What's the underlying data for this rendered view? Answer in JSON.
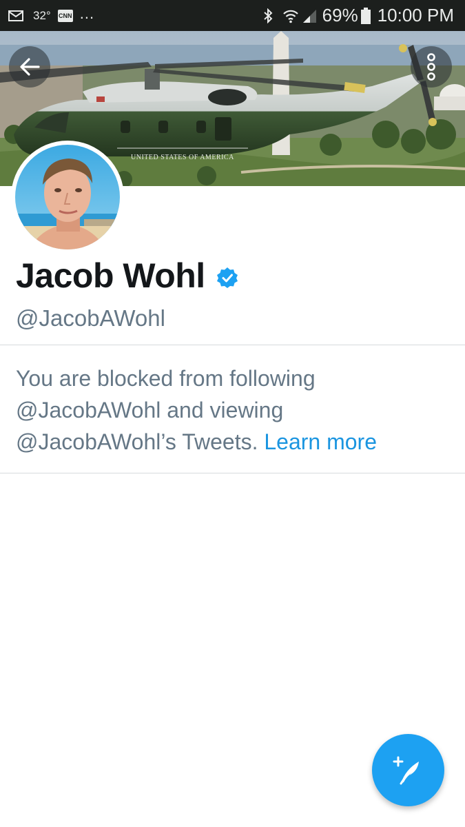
{
  "status_bar": {
    "temperature": "32°",
    "news_badge": "CNN",
    "more_indicator": "...",
    "battery_percent": "69%",
    "time": "10:00 PM",
    "icons": [
      "mail-icon",
      "cnn-icon",
      "bluetooth-icon",
      "wifi-icon",
      "signal-icon",
      "battery-icon"
    ]
  },
  "header": {
    "banner_text": "UNITED STATES OF AMERICA",
    "back_icon": "arrow-left-icon",
    "overflow_icon": "more-vertical-icon"
  },
  "profile": {
    "display_name": "Jacob Wohl",
    "verified": true,
    "handle": "@JacobAWohl"
  },
  "blocked_notice": {
    "message": "You are blocked from following @JacobAWohl and viewing @JacobAWohl’s Tweets.",
    "link_text": "Learn more"
  },
  "compose": {
    "icon": "compose-tweet-icon"
  },
  "colors": {
    "accent": "#1da1f2",
    "link": "#1b95e0",
    "secondary_text": "#657786",
    "primary_text": "#14171a",
    "status_bar_bg": "#1c1f1d"
  }
}
